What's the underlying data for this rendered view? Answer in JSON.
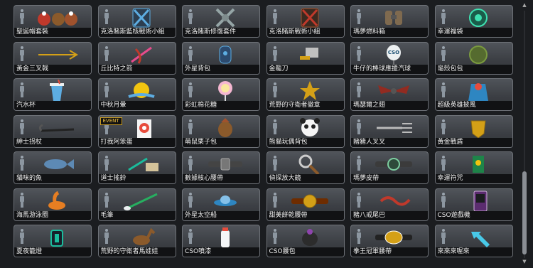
{
  "items": [
    {
      "label": "聖誕帽套裝",
      "icon": "christmas-hat-set-icon"
    },
    {
      "label": "克洛賭斯藍核戰術小組",
      "icon": "blue-core-tactical-unit-icon"
    },
    {
      "label": "克洛賭斯修復套件",
      "icon": "repair-kit-icon"
    },
    {
      "label": "克洛賭斯戰術小組",
      "icon": "tactical-unit-icon"
    },
    {
      "label": "瑪夢燃料箱",
      "icon": "fuel-tank-icon"
    },
    {
      "label": "幸運福袋",
      "icon": "lucky-bag-icon"
    },
    {
      "label": "黃金三叉戟",
      "icon": "golden-trident-icon"
    },
    {
      "label": "丘比特之箭",
      "icon": "cupid-arrow-icon"
    },
    {
      "label": "外星背包",
      "icon": "alien-backpack-icon"
    },
    {
      "label": "金龍刀",
      "icon": "golden-dragon-knife-icon"
    },
    {
      "label": "牛仔的棒球應援汽球",
      "icon": "baseball-balloon-icon",
      "icon_text": "CSO"
    },
    {
      "label": "龜殼包包",
      "icon": "turtle-shell-bag-icon"
    },
    {
      "label": "汽水杯",
      "icon": "soda-cup-icon"
    },
    {
      "label": "中秋月暈",
      "icon": "mid-autumn-moon-icon"
    },
    {
      "label": "彩虹棉花糖",
      "icon": "rainbow-cotton-candy-icon"
    },
    {
      "label": "荒野的守衛者徽章",
      "icon": "sheriff-badge-icon"
    },
    {
      "label": "瑪瑟爾之翅",
      "icon": "wings-icon"
    },
    {
      "label": "超級英雄披風",
      "icon": "superhero-cape-icon"
    },
    {
      "label": "紳士拐杖",
      "icon": "gentleman-cane-icon"
    },
    {
      "label": "打我阿笨蛋",
      "icon": "target-icon",
      "badge": "EVENT"
    },
    {
      "label": "萌鼠栗子包",
      "icon": "chestnut-bag-icon"
    },
    {
      "label": "熊貓玩偶背包",
      "icon": "panda-backpack-icon"
    },
    {
      "label": "豬豬人叉叉",
      "icon": "fork-icon"
    },
    {
      "label": "黃金戰盾",
      "icon": "golden-shield-icon"
    },
    {
      "label": "貓咪的魚",
      "icon": "fish-icon"
    },
    {
      "label": "道士搖鈴",
      "icon": "taoist-bell-icon"
    },
    {
      "label": "數據核心腰帶",
      "icon": "data-core-belt-icon"
    },
    {
      "label": "偵探放大鏡",
      "icon": "magnifier-icon"
    },
    {
      "label": "瑪夢皮帶",
      "icon": "belt-icon"
    },
    {
      "label": "幸運符咒",
      "icon": "lucky-charm-icon"
    },
    {
      "label": "海馬游泳圈",
      "icon": "seahorse-float-icon"
    },
    {
      "label": "毛筆",
      "icon": "brush-icon"
    },
    {
      "label": "外星太空船",
      "icon": "ufo-icon"
    },
    {
      "label": "甜美餅乾腰帶",
      "icon": "cookie-belt-icon"
    },
    {
      "label": "豬八戒尾巴",
      "icon": "pig-tail-icon"
    },
    {
      "label": "CSO遊戲機",
      "icon": "game-console-icon"
    },
    {
      "label": "夏夜籠燈",
      "icon": "lantern-icon"
    },
    {
      "label": "荒野的守衛者馬娃娃",
      "icon": "horse-doll-icon"
    },
    {
      "label": "CSO噴漆",
      "icon": "spray-can-icon"
    },
    {
      "label": "CSO腰包",
      "icon": "waist-bag-icon"
    },
    {
      "label": "拳王冠軍腰帶",
      "icon": "champion-belt-icon"
    },
    {
      "label": "來來來喔來",
      "icon": "cyan-arrow-icon"
    }
  ],
  "scrollbar": {
    "position_fraction": 0.64,
    "visible_fraction": 0.34
  }
}
